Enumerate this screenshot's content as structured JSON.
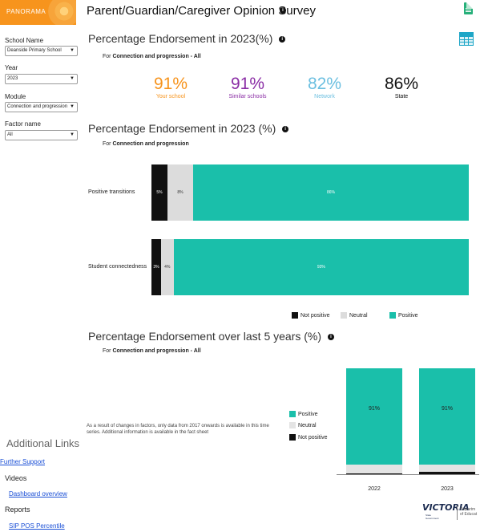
{
  "app": {
    "logo_text": "PANORAMA"
  },
  "header": {
    "title": "Parent/Guardian/Caregiver Opinion Survey",
    "info": "i"
  },
  "filters": {
    "school": {
      "label": "School Name",
      "value": "Deanside Primary School"
    },
    "year": {
      "label": "Year",
      "value": "2023"
    },
    "module": {
      "label": "Module",
      "value": "Connection and progression"
    },
    "factor": {
      "label": "Factor name",
      "value": "All"
    }
  },
  "section1": {
    "title": "Percentage Endorsement in 2023(%)",
    "sub_prefix": "For ",
    "sub_bold": "Connection and progression - All",
    "kpis": [
      {
        "value": "91%",
        "label": "Your school",
        "color": "#f7941d"
      },
      {
        "value": "91%",
        "label": "Similar schools",
        "color": "#8a2da5"
      },
      {
        "value": "82%",
        "label": "Network",
        "color": "#6bbfe0"
      },
      {
        "value": "86%",
        "label": "State",
        "color": "#111111"
      }
    ]
  },
  "section2": {
    "title": "Percentage Endorsement in 2023 (%)",
    "sub_prefix": "For ",
    "sub_bold": "Connection and progression",
    "legend": [
      {
        "label": "Not positive",
        "color": "#111111"
      },
      {
        "label": "Neutral",
        "color": "#dcdcdc"
      },
      {
        "label": "Positive",
        "color": "#1abfaa"
      }
    ]
  },
  "section3": {
    "title": "Percentage Endorsement over last 5 years (%)",
    "sub_prefix": "For ",
    "sub_bold": "Connection and progression - All",
    "note": "As a result of changes in factors, only data from 2017 onwards is available in this time series. Additional information is available in the fact sheet",
    "legend": [
      {
        "label": "Positive",
        "color": "#1abfaa"
      },
      {
        "label": "Neutral",
        "color": "#dcdcdc"
      },
      {
        "label": "Not positive",
        "color": "#111111"
      }
    ]
  },
  "sidebar_links": {
    "title": "Additional Links",
    "further_support": "Further Support",
    "videos_heading": "Videos",
    "dashboard_overview": "Dashboard overview",
    "reports_heading": "Reports",
    "sip_pos": "SIP POS Percentile"
  },
  "footer_logo": {
    "mark": "VICTORIA",
    "sub1": "State",
    "sub2": "Government",
    "dept1": "Departm",
    "dept2": "of Educat"
  },
  "chart_data": [
    {
      "type": "bar",
      "orientation": "horizontal-stacked",
      "categories": [
        "Positive transitions",
        "Student connectedness"
      ],
      "series": [
        {
          "name": "Not positive",
          "values": [
            5,
            3
          ],
          "labels": [
            "5%",
            "3%"
          ]
        },
        {
          "name": "Neutral",
          "values": [
            8,
            4
          ],
          "labels": [
            "8%",
            "4%"
          ]
        },
        {
          "name": "Positive",
          "values": [
            86,
            93
          ],
          "labels": [
            "86%",
            "93%"
          ]
        }
      ],
      "legend": "bottom-right"
    },
    {
      "type": "bar",
      "orientation": "vertical-stacked",
      "categories": [
        "2022",
        "2023"
      ],
      "series": [
        {
          "name": "Positive",
          "values": [
            91,
            91
          ],
          "labels": [
            "91%",
            "91%"
          ]
        },
        {
          "name": "Neutral",
          "values": [
            8,
            7
          ]
        },
        {
          "name": "Not positive",
          "values": [
            1,
            2
          ]
        }
      ],
      "ylim": [
        0,
        100
      ],
      "legend": "left"
    }
  ]
}
